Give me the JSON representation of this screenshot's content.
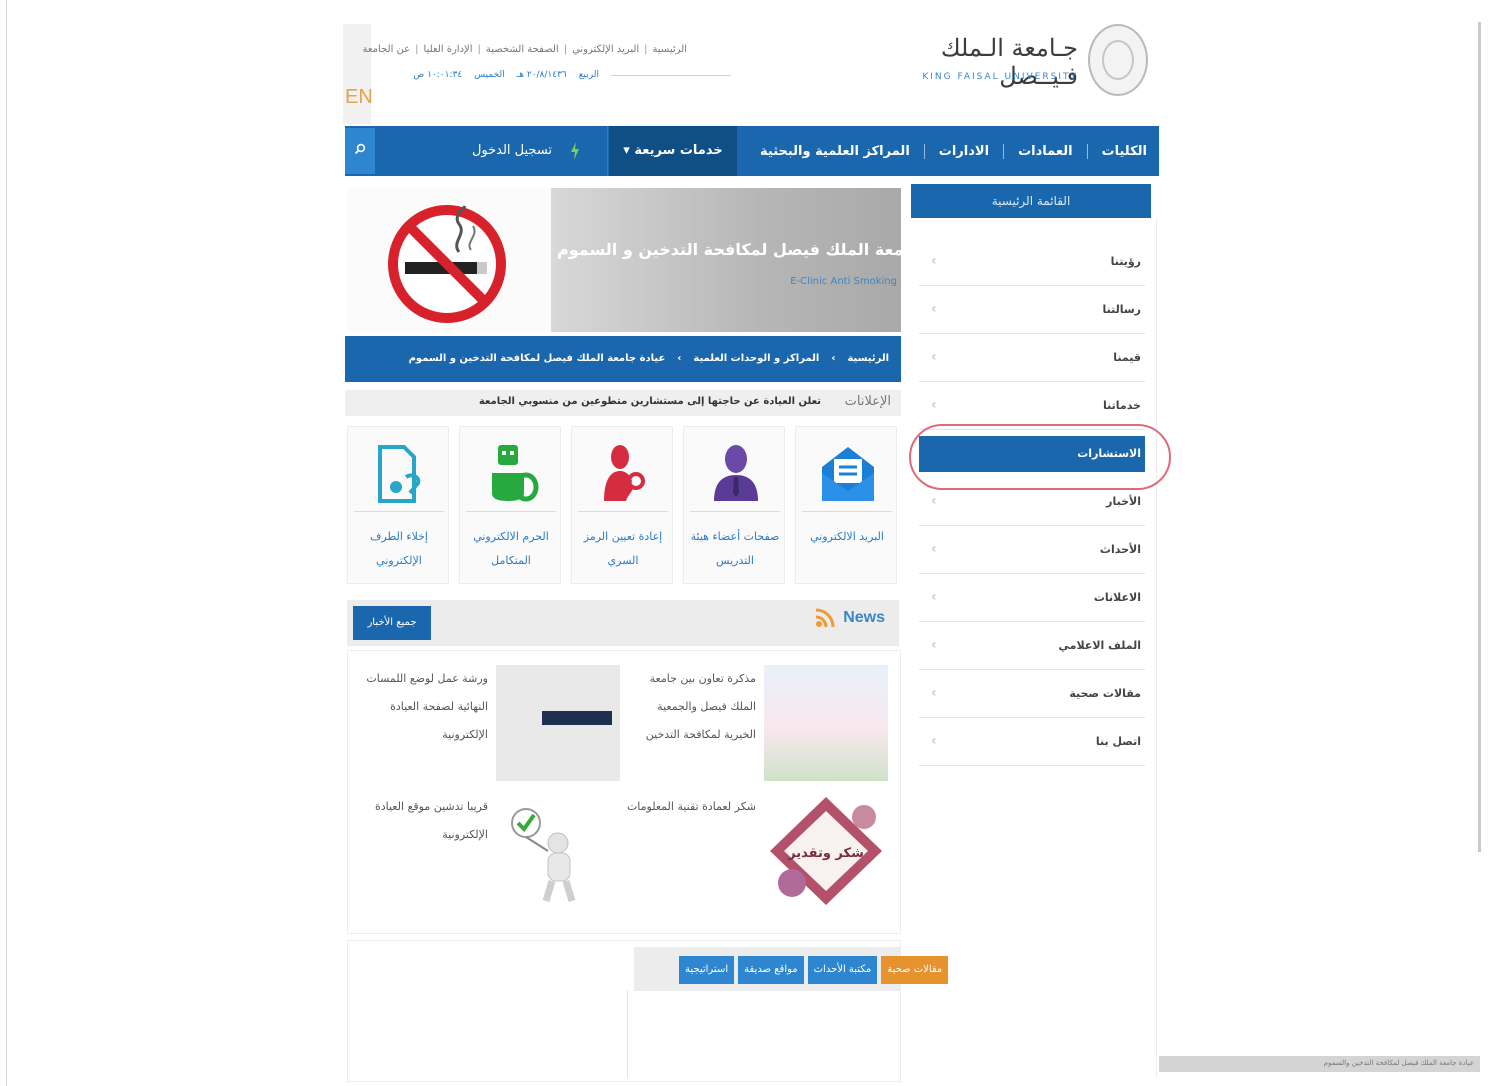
{
  "header": {
    "lang_switch": "EN",
    "university_name_ar": "جـامعة الـملك فـيــصل",
    "university_name_en": "KING FAISAL UNIVERSITY",
    "top_links": [
      "الرئيسية",
      "البريد الإلكتروني",
      "الصفحة الشخصية",
      "الإدارة العليا",
      "عن الجامعة"
    ],
    "date_items": [
      "الربيع",
      "٢٠/٨/١٤٣٦ هـ",
      "الخميس",
      "١٠:٠١:٣٤ ص"
    ]
  },
  "nav": {
    "items": [
      "الكليات",
      "العمادات",
      "الادارات",
      "المراكز العلمية والبحثية"
    ],
    "quick_services": "خدمات سريعة",
    "login": "تسجيل الدخول",
    "search_icon": "search-icon"
  },
  "banner": {
    "title": "عيادة جامعة الملك فيصل لمكافحة التدخين و السموم",
    "subtitle": "E-Clinic Anti Smoking",
    "breadcrumbs": [
      "الرئيسية",
      "المراكز و الوحدات العلمية",
      "عيادة جامعة الملك فيصل لمكافحة التدخين و السموم"
    ]
  },
  "announcement": {
    "label": "الإعلانات",
    "text": "تعلن العيادة عن حاجتها إلى مستشارين متطوعين من منسوبي الجامعة"
  },
  "services": [
    {
      "label": "البريد الالكتروني",
      "icon": "envelope-icon",
      "color": "#1c7fd6"
    },
    {
      "label": "صفحات أعضاء هيئة التدريس",
      "icon": "person-icon",
      "color": "#6a4aa6"
    },
    {
      "label": "إعادة تعيين الرمز السري",
      "icon": "key-person-icon",
      "color": "#d62c40"
    },
    {
      "label": "الحرم الالكتروني المتكامل",
      "icon": "robot-icon",
      "color": "#26a93f"
    },
    {
      "label": "إخلاء الطرف الإلكتروني",
      "icon": "document-icon",
      "color": "#28a6c7"
    }
  ],
  "news": {
    "title": "News",
    "all_button": "جميع الأخبار",
    "items": [
      {
        "text": "مذكرة تعاون بين جامعة الملك فيصل والجمعية الخيرية لمكافحة التدخين"
      },
      {
        "text": "ورشة عمل لوضع اللمسات النهائية لصفحة العيادة الإلكترونية"
      },
      {
        "text": "شكر لعمادة تقنية المعلومات",
        "image_caption": "شكر وتقدير"
      },
      {
        "text": "قريبا تدشين موقع العيادة الإلكترونية"
      }
    ]
  },
  "bottom_tabs": [
    "مقالات صحية",
    "مكتبة الأحداث",
    "مواقع صديقة",
    "استراتيجية"
  ],
  "sidebar": {
    "title": "القائمة الرئيسية",
    "items": [
      "رؤيتنا",
      "رسالتنا",
      "قيمنا",
      "خدماتنا",
      "الاستشارات",
      "الأخبار",
      "الأحداث",
      "الاعلانات",
      "الملف الاعلامي",
      "مقالات صحية",
      "اتصل بنا"
    ],
    "active_index": 4
  },
  "status_bar": {
    "text": "عيادة جامعة الملك فيصل لمكافحة التدخين والسموم"
  },
  "colors": {
    "primary_blue": "#1a67ad",
    "dark_blue": "#0f4f86",
    "accent_orange": "#e6932f",
    "highlight_ring": "#e06b78"
  }
}
